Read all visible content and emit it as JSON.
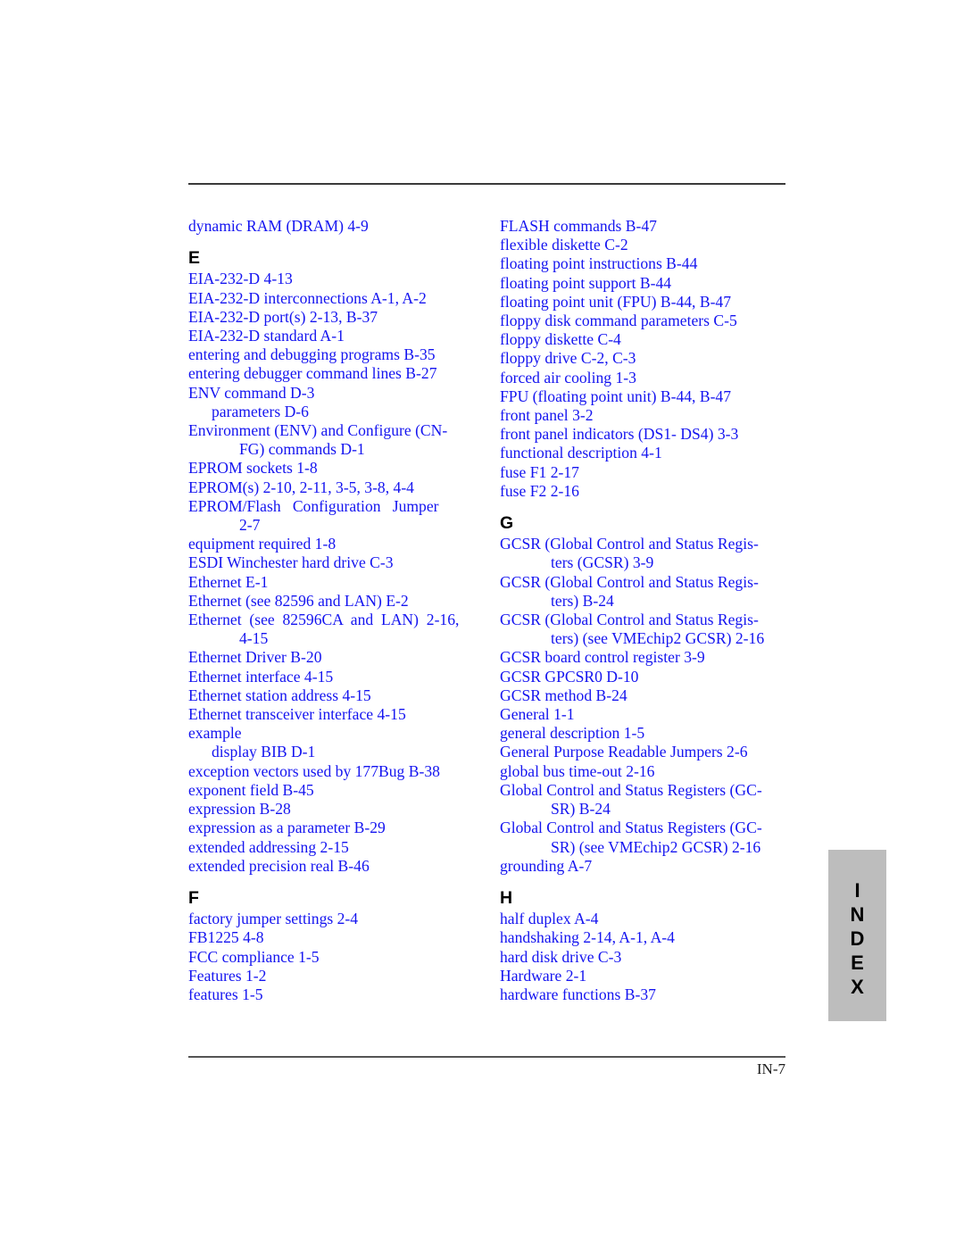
{
  "page": {
    "footer_page_number": "IN-7",
    "thumb_tab_letters": [
      "I",
      "N",
      "D",
      "E",
      "X"
    ],
    "text_color": "#1414f0",
    "heading_color": "#000000",
    "tab_background": "#bdbdbd"
  },
  "columns": {
    "left": [
      {
        "kind": "entry",
        "text": "dynamic RAM (DRAM) 4-9"
      },
      {
        "kind": "letter",
        "text": "E"
      },
      {
        "kind": "entry",
        "text": "EIA-232-D 4-13"
      },
      {
        "kind": "entry",
        "text": "EIA-232-D interconnections A-1, A-2"
      },
      {
        "kind": "entry",
        "text": "EIA-232-D port(s) 2-13, B-37"
      },
      {
        "kind": "entry",
        "text": "EIA-232-D standard A-1"
      },
      {
        "kind": "entry",
        "text": "entering and debugging programs B-35"
      },
      {
        "kind": "entry",
        "text": "entering debugger command lines B-27"
      },
      {
        "kind": "entry",
        "text": "ENV command D-3"
      },
      {
        "kind": "sub",
        "text": "parameters D-6"
      },
      {
        "kind": "entry",
        "text": "Environment (ENV) and Configure (CN-"
      },
      {
        "kind": "cont",
        "text": "FG) commands D-1"
      },
      {
        "kind": "entry",
        "text": "EPROM sockets 1-8"
      },
      {
        "kind": "entry",
        "text": "EPROM(s) 2-10, 2-11, 3-5, 3-8, 4-4"
      },
      {
        "kind": "entry",
        "text": "EPROM/Flash   Configuration   Jumper"
      },
      {
        "kind": "cont",
        "text": "2-7"
      },
      {
        "kind": "entry",
        "text": "equipment required 1-8"
      },
      {
        "kind": "entry",
        "text": "ESDI Winchester hard drive C-3"
      },
      {
        "kind": "entry",
        "text": "Ethernet E-1"
      },
      {
        "kind": "entry",
        "text": "Ethernet (see 82596 and LAN) E-2"
      },
      {
        "kind": "entry",
        "text": "Ethernet  (see  82596CA  and  LAN)  2-16,"
      },
      {
        "kind": "cont",
        "text": "4-15"
      },
      {
        "kind": "entry",
        "text": "Ethernet Driver B-20"
      },
      {
        "kind": "entry",
        "text": "Ethernet interface 4-15"
      },
      {
        "kind": "entry",
        "text": "Ethernet station address 4-15"
      },
      {
        "kind": "entry",
        "text": "Ethernet transceiver interface 4-15"
      },
      {
        "kind": "entry",
        "text": "example"
      },
      {
        "kind": "sub",
        "text": "display BIB D-1"
      },
      {
        "kind": "entry",
        "text": "exception vectors used by 177Bug B-38"
      },
      {
        "kind": "entry",
        "text": "exponent field B-45"
      },
      {
        "kind": "entry",
        "text": "expression B-28"
      },
      {
        "kind": "entry",
        "text": "expression as a parameter B-29"
      },
      {
        "kind": "entry",
        "text": "extended addressing 2-15"
      },
      {
        "kind": "entry",
        "text": "extended precision real B-46"
      },
      {
        "kind": "letter",
        "text": "F"
      },
      {
        "kind": "entry",
        "text": "factory jumper settings 2-4"
      },
      {
        "kind": "entry",
        "text": "FB1225 4-8"
      },
      {
        "kind": "entry",
        "text": "FCC compliance 1-5"
      },
      {
        "kind": "entry",
        "text": "Features 1-2"
      },
      {
        "kind": "entry",
        "text": "features 1-5"
      }
    ],
    "right": [
      {
        "kind": "entry",
        "text": "FLASH commands B-47"
      },
      {
        "kind": "entry",
        "text": "flexible diskette C-2"
      },
      {
        "kind": "entry",
        "text": "floating point instructions B-44"
      },
      {
        "kind": "entry",
        "text": "floating point support B-44"
      },
      {
        "kind": "entry",
        "text": "floating point unit (FPU) B-44, B-47"
      },
      {
        "kind": "entry",
        "text": "floppy disk command parameters C-5"
      },
      {
        "kind": "entry",
        "text": "floppy diskette C-4"
      },
      {
        "kind": "entry",
        "text": "floppy drive C-2, C-3"
      },
      {
        "kind": "entry",
        "text": "forced air cooling 1-3"
      },
      {
        "kind": "entry",
        "text": "FPU (floating point unit) B-44, B-47"
      },
      {
        "kind": "entry",
        "text": "front panel 3-2"
      },
      {
        "kind": "entry",
        "text": "front panel indicators (DS1- DS4) 3-3"
      },
      {
        "kind": "entry",
        "text": "functional description 4-1"
      },
      {
        "kind": "entry",
        "text": "fuse F1 2-17"
      },
      {
        "kind": "entry",
        "text": "fuse F2 2-16"
      },
      {
        "kind": "letter",
        "text": "G"
      },
      {
        "kind": "entry",
        "text": "GCSR (Global Control and Status Regis-"
      },
      {
        "kind": "cont",
        "text": "ters (GCSR) 3-9"
      },
      {
        "kind": "entry",
        "text": "GCSR (Global Control and Status Regis-"
      },
      {
        "kind": "cont",
        "text": "ters) B-24"
      },
      {
        "kind": "entry",
        "text": "GCSR (Global Control and Status Regis-"
      },
      {
        "kind": "cont",
        "text": "ters) (see VMEchip2 GCSR) 2-16"
      },
      {
        "kind": "entry",
        "text": "GCSR board control register 3-9"
      },
      {
        "kind": "entry",
        "text": "GCSR GPCSR0 D-10"
      },
      {
        "kind": "entry",
        "text": "GCSR method B-24"
      },
      {
        "kind": "entry",
        "text": "General 1-1"
      },
      {
        "kind": "entry",
        "text": "general description 1-5"
      },
      {
        "kind": "entry",
        "text": "General Purpose Readable Jumpers 2-6"
      },
      {
        "kind": "entry",
        "text": "global bus time-out 2-16"
      },
      {
        "kind": "entry",
        "text": "Global Control and Status Registers (GC-"
      },
      {
        "kind": "cont",
        "text": "SR) B-24"
      },
      {
        "kind": "entry",
        "text": "Global Control and Status Registers (GC-"
      },
      {
        "kind": "cont",
        "text": "SR) (see VMEchip2 GCSR) 2-16"
      },
      {
        "kind": "entry",
        "text": "grounding A-7"
      },
      {
        "kind": "letter",
        "text": "H"
      },
      {
        "kind": "entry",
        "text": "half duplex A-4"
      },
      {
        "kind": "entry",
        "text": "handshaking 2-14, A-1, A-4"
      },
      {
        "kind": "entry",
        "text": "hard disk drive C-3"
      },
      {
        "kind": "entry",
        "text": "Hardware 2-1"
      },
      {
        "kind": "entry",
        "text": "hardware functions B-37"
      }
    ]
  }
}
